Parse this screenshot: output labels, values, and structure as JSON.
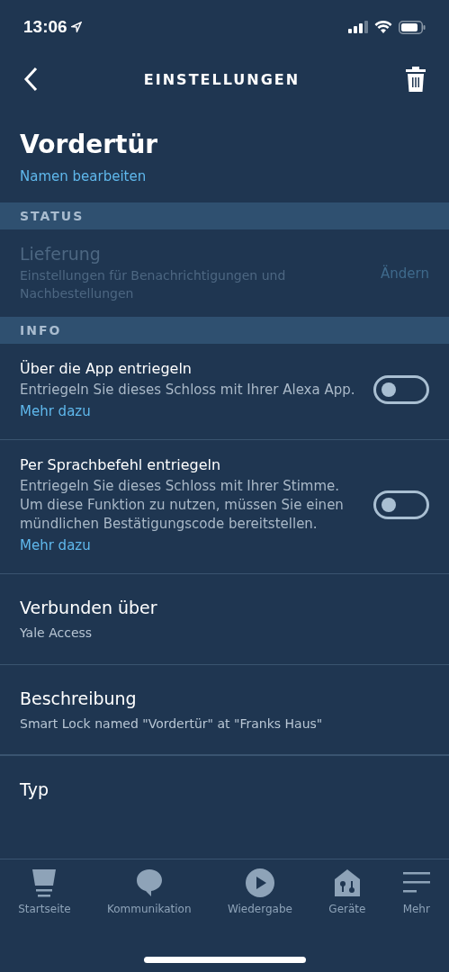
{
  "status_bar": {
    "time": "13:06"
  },
  "nav": {
    "title": "EINSTELLUNGEN"
  },
  "device": {
    "name": "Vordertür",
    "edit_link": "Namen bearbeiten"
  },
  "sections": [
    {
      "header": "STATUS",
      "rows": [
        {
          "kind": "action",
          "title": "Lieferung",
          "subtitle": "Einstellungen für Benachrichtigungen und Nachbestellungen",
          "action": "Ändern",
          "disabled": true
        }
      ]
    },
    {
      "header": "INFO",
      "rows": [
        {
          "kind": "toggle",
          "title": "Über die App entriegeln",
          "subtitle": "Entriegeln Sie dieses Schloss mit Ihrer Alexa App.",
          "link": "Mehr dazu",
          "on": false
        },
        {
          "kind": "toggle",
          "title": "Per Sprachbefehl entriegeln",
          "subtitle": "Entriegeln Sie dieses Schloss mit Ihrer Stimme. Um diese Funktion zu nutzen, müssen Sie einen mündlichen Bestätigungscode bereitstellen.",
          "link": "Mehr dazu",
          "on": false
        },
        {
          "kind": "info",
          "title": "Verbunden über",
          "subtitle": "Yale Access"
        },
        {
          "kind": "info",
          "title": "Beschreibung",
          "subtitle": "Smart Lock named \"Vordertür\" at \"Franks Haus\""
        },
        {
          "kind": "info",
          "title": "Typ"
        }
      ]
    }
  ],
  "tab_bar": [
    {
      "label": "Startseite",
      "kind": "home",
      "selected": false
    },
    {
      "label": "Kommunikation",
      "kind": "chat",
      "selected": false
    },
    {
      "label": "Wiedergabe",
      "kind": "play",
      "selected": false
    },
    {
      "label": "Geräte",
      "kind": "devices",
      "selected": false
    },
    {
      "label": "Mehr",
      "kind": "more",
      "selected": false
    }
  ]
}
